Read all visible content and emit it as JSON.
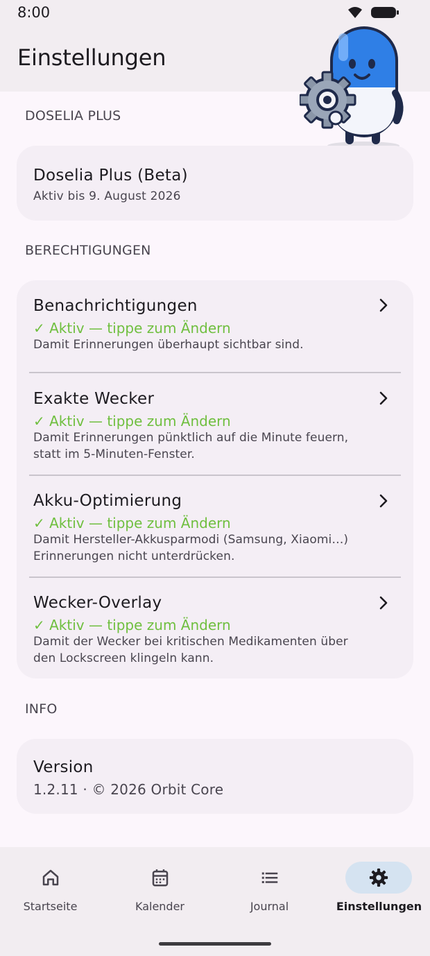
{
  "status_bar": {
    "time": "8:00"
  },
  "header": {
    "title": "Einstellungen"
  },
  "sections": {
    "plus": {
      "label": "DOSELIA PLUS",
      "title": "Doselia Plus (Beta)",
      "subtitle": "Aktiv bis 9. August 2026"
    },
    "permissions": {
      "label": "BERECHTIGUNGEN",
      "items": [
        {
          "title": "Benachrichtigungen",
          "status": "✓ Aktiv — tippe zum Ändern",
          "desc": "Damit Erinnerungen überhaupt sichtbar sind."
        },
        {
          "title": "Exakte Wecker",
          "status": "✓ Aktiv — tippe zum Ändern",
          "desc": "Damit Erinnerungen pünktlich auf die Minute feuern, statt im 5-Minuten-Fenster."
        },
        {
          "title": "Akku-Optimierung",
          "status": "✓ Aktiv — tippe zum Ändern",
          "desc": "Damit Hersteller-Akkusparmodi (Samsung, Xiaomi…) Erinnerungen nicht unterdrücken."
        },
        {
          "title": "Wecker-Overlay",
          "status": "✓ Aktiv — tippe zum Ändern",
          "desc": "Damit der Wecker bei kritischen Medikamenten über den Lockscreen klingeln kann."
        }
      ]
    },
    "info": {
      "label": "INFO",
      "title": "Version",
      "subtitle": "1.2.11 · © 2026 Orbit Core"
    }
  },
  "bottom_nav": {
    "items": [
      {
        "label": "Startseite",
        "icon": "home-icon"
      },
      {
        "label": "Kalender",
        "icon": "calendar-icon"
      },
      {
        "label": "Journal",
        "icon": "list-icon"
      },
      {
        "label": "Einstellungen",
        "icon": "gear-icon",
        "active": true
      }
    ]
  },
  "colors": {
    "status_active": "#6fbf3f",
    "nav_active_pill": "#d5e3f1",
    "card_bg": "#f4eef5"
  }
}
